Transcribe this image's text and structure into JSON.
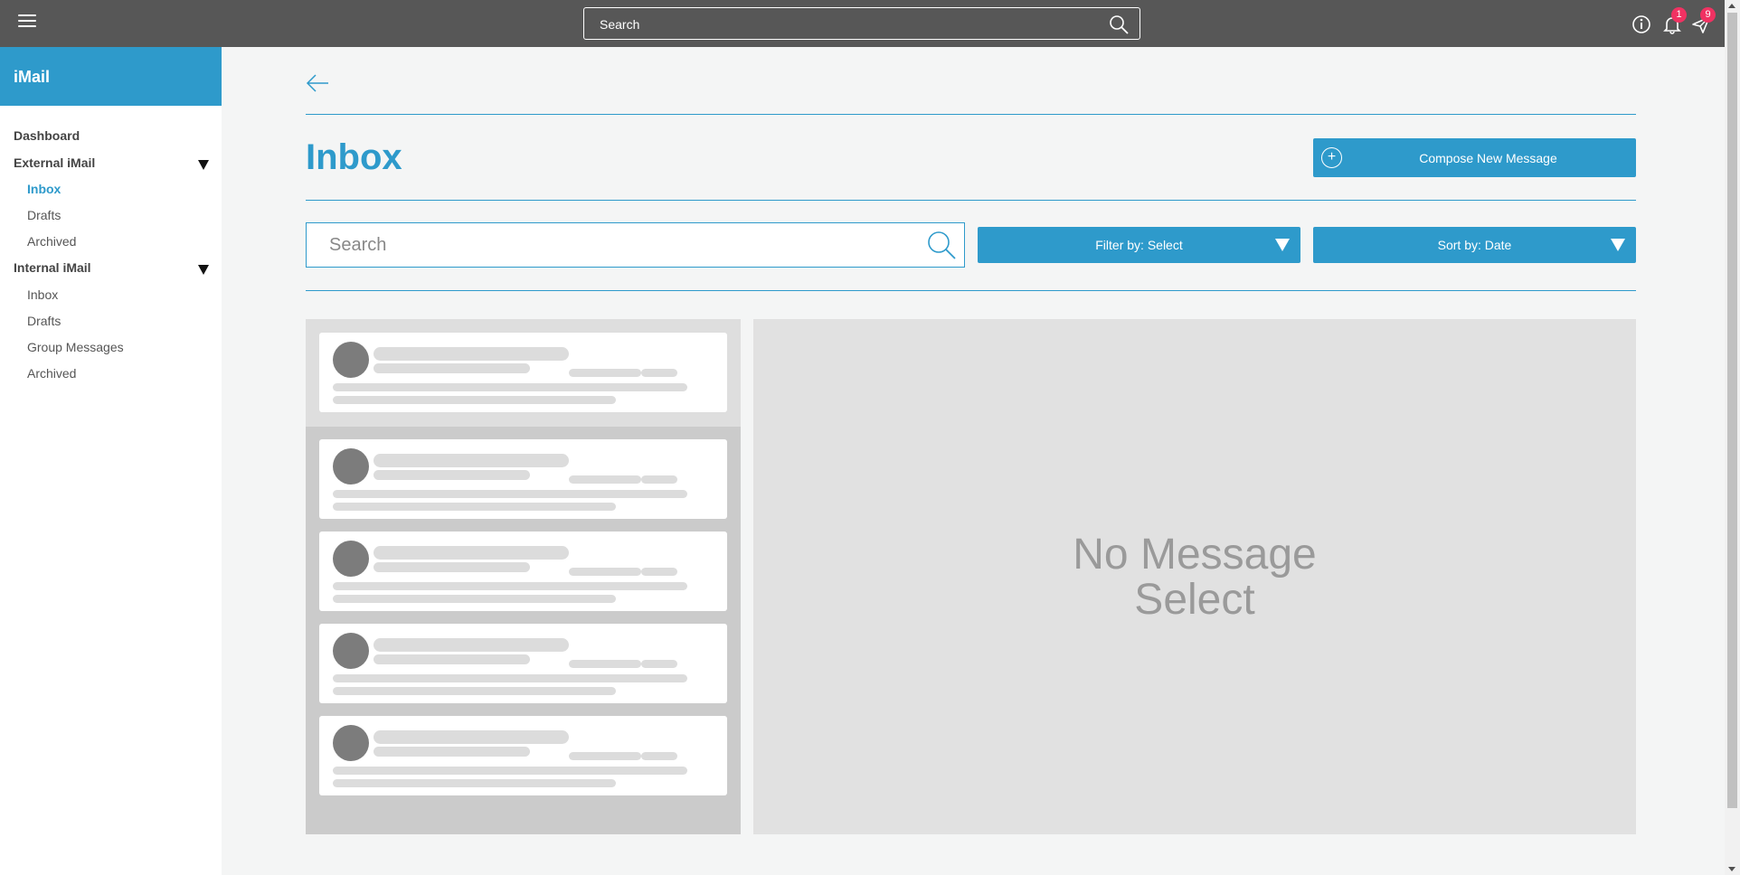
{
  "topbar": {
    "search_placeholder": "Search",
    "notifications_count": "1",
    "messages_count": "9",
    "accent": "#575757"
  },
  "sidebar": {
    "brand": "iMail",
    "sections": [
      {
        "label": "Dashboard"
      },
      {
        "label": "External iMail",
        "items": [
          "Inbox",
          "Drafts",
          "Archived"
        ]
      },
      {
        "label": "Internal iMail",
        "items": [
          "Inbox",
          "Drafts",
          "Group Messages",
          "Archived"
        ]
      }
    ],
    "active_item": "External iMail > Inbox",
    "accent": "#2e9acb"
  },
  "main": {
    "title": "Inbox",
    "compose_label": "Compose New Message",
    "search_placeholder": "Search",
    "filter_label": "Filter by: Select",
    "sort_label": "Sort by: Date",
    "empty_viewer_line1": "No Message",
    "empty_viewer_line2": "Select"
  },
  "icons": {
    "menu": "hamburger-icon",
    "search": "search-icon",
    "info": "info-icon",
    "notifications": "bell-icon",
    "messages": "send-icon",
    "back": "arrow-left-icon",
    "compose": "plus-circle-icon"
  }
}
